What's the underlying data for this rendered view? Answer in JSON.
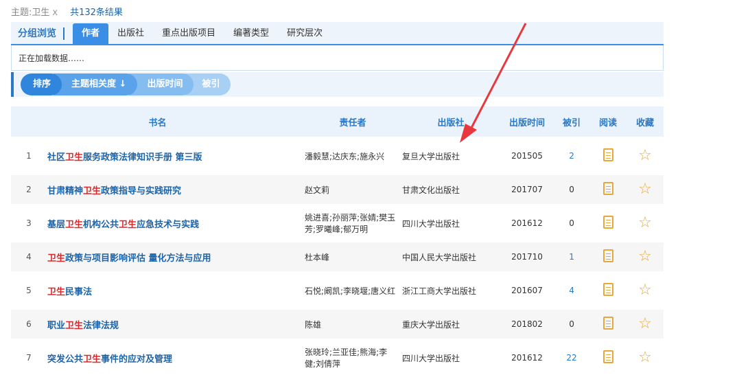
{
  "topbar": {
    "topic": "主题:卫生",
    "remove": "x",
    "result_count": "共132条结果"
  },
  "group_nav": {
    "title": "分组浏览",
    "tabs": [
      {
        "label": "作者",
        "active": true
      },
      {
        "label": "出版社"
      },
      {
        "label": "重点出版项目"
      },
      {
        "label": "编著类型"
      },
      {
        "label": "研究层次"
      }
    ]
  },
  "loading_text": "正在加载数据……",
  "sort": {
    "label": "排序",
    "options": [
      "主题相关度 ↓",
      "出版时间",
      "被引"
    ]
  },
  "table": {
    "headers": [
      "书名",
      "责任者",
      "出版社",
      "出版时间",
      "被引",
      "阅读",
      "收藏"
    ],
    "rows": [
      {
        "n": "1",
        "t1": "社区",
        "t2": "卫生",
        "t3": "服务政策法律知识手册  第三版",
        "t4": "",
        "t5": "",
        "author": "潘毅慧;达庆东;施永兴",
        "publisher": "复旦大学出版社",
        "date": "201505",
        "cite": "2"
      },
      {
        "n": "2",
        "t1": "甘肃精神",
        "t2": "卫生",
        "t3": "政策指导与实践研究",
        "t4": "",
        "t5": "",
        "author": "赵文莉",
        "publisher": "甘肃文化出版社",
        "date": "201707",
        "cite": "0"
      },
      {
        "n": "3",
        "t1": "基层",
        "t2": "卫生",
        "t3": "机构公共",
        "t4": "卫生",
        "t5": "应急技术与实践",
        "author": "姚进喜;孙丽萍;张婧;樊玉芳;罗曦峰;郁万明",
        "publisher": "四川大学出版社",
        "date": "201612",
        "cite": "0"
      },
      {
        "n": "4",
        "t1": "",
        "t2": "卫生",
        "t3": "政策与项目影响评估  量化方法与应用",
        "t4": "",
        "t5": "",
        "author": "杜本峰",
        "publisher": "中国人民大学出版社",
        "date": "201710",
        "cite": "1"
      },
      {
        "n": "5",
        "t1": "",
        "t2": "卫生",
        "t3": "民事法",
        "t4": "",
        "t5": "",
        "author": "石悦;阚凯;李晓堰;唐义红",
        "publisher": "浙江工商大学出版社",
        "date": "201607",
        "cite": "4"
      },
      {
        "n": "6",
        "t1": "职业",
        "t2": "卫生",
        "t3": "法律法规",
        "t4": "",
        "t5": "",
        "author": "陈雄",
        "publisher": "重庆大学出版社",
        "date": "201802",
        "cite": "0"
      },
      {
        "n": "7",
        "t1": "突发公共",
        "t2": "卫生",
        "t3": "事件的应对及管理",
        "t4": "",
        "t5": "",
        "author": "张晓玲;兰亚佳;熊海;李健;刘倩萍",
        "publisher": "四川大学出版社",
        "date": "201612",
        "cite": "22"
      }
    ]
  },
  "colors": {
    "accent": "#3a8ee6",
    "highlight": "#d9292c",
    "title": "#1e64a8",
    "icon": "#e8a73a",
    "arrow": "#e8383d"
  },
  "icons": {
    "read": "book-icon",
    "favorite": "star-outline-icon"
  }
}
